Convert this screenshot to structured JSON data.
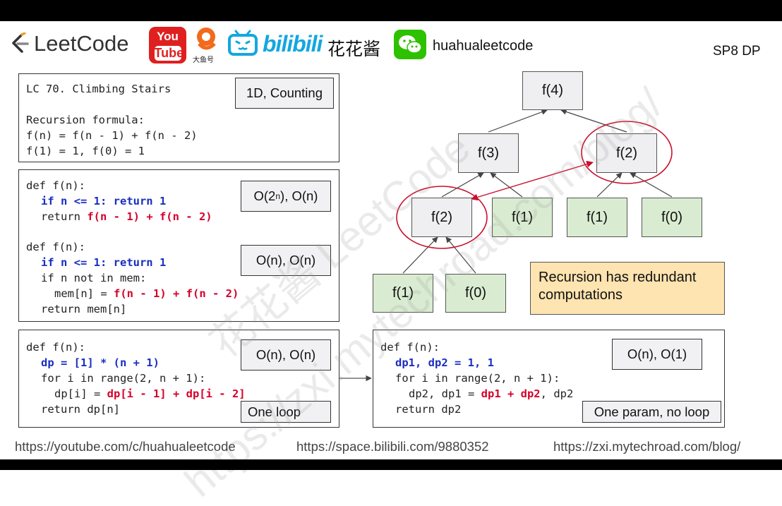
{
  "header": {
    "logo_text": "LeetCode",
    "youtube_you": "You",
    "youtube_tube": "Tube",
    "dayuhao": "大鱼号",
    "bilibili": "bilibili",
    "channel_cn": "花花酱",
    "wechat_id": "huahualeetcode",
    "series": "SP8 DP"
  },
  "problem": {
    "title": "LC 70. Climbing Stairs",
    "tag": "1D, Counting",
    "formula_heading": "Recursion formula:",
    "formula_1": "f(n) = f(n - 1) + f(n - 2)",
    "formula_2": "f(1) = 1, f(0) = 1"
  },
  "recursion": {
    "def": "def f(n):",
    "base_kw": "if n <= 1: return 1",
    "return_prefix": "return ",
    "return_expr": "f(n - 1) + f(n - 2)",
    "complexity_base": "O(2",
    "complexity_exp": "n",
    "complexity_rest": "), O(n)"
  },
  "memo": {
    "def": "def f(n):",
    "base_kw": "if n <= 1: return 1",
    "check": "if n not in mem:",
    "assign_prefix": "mem[n] = ",
    "assign_expr": "f(n - 1) + f(n - 2)",
    "return": "return mem[n]",
    "complexity": "O(n), O(n)"
  },
  "dp": {
    "def": "def f(n):",
    "init": "dp = [1] * (n + 1)",
    "loop": "for i in range(2, n + 1):",
    "assign_prefix": "dp[i] = ",
    "assign_expr": "dp[i - 1] + dp[i - 2]",
    "return": "return dp[n]",
    "complexity": "O(n), O(n)",
    "note": "One loop"
  },
  "dp2": {
    "def": "def f(n):",
    "init": "dp1, dp2 = 1, 1",
    "loop": "for i in range(2, n + 1):",
    "assign_prefix": "dp2, dp1 = ",
    "assign_expr": "dp1 + dp2",
    "assign_suffix": ", dp2",
    "return": "return dp2",
    "complexity": "O(n), O(1)",
    "note": "One param, no loop"
  },
  "tree": {
    "root": "f(4)",
    "l1_left": "f(3)",
    "l1_right": "f(2)",
    "l2_a": "f(2)",
    "l2_b": "f(1)",
    "l2_c": "f(1)",
    "l2_d": "f(0)",
    "l3_a": "f(1)",
    "l3_b": "f(0)"
  },
  "callout": "Recursion has redundant computations",
  "watermark_1": "花花酱 LeetCode",
  "watermark_2": "https://zxi.mytechroad.com/blog/",
  "footer": {
    "youtube": "https://youtube.com/c/huahualeetcode",
    "bilibili": "https://space.bilibili.com/9880352",
    "blog": "https://zxi.mytechroad.com/blog/"
  },
  "colors": {
    "keyword_blue": "#1a2ec0",
    "keyword_red": "#d5002a",
    "node_gray": "#efeff1",
    "node_green": "#d9ecd1",
    "callout_bg": "#fde4b0",
    "highlight_circle": "#c8102e"
  }
}
